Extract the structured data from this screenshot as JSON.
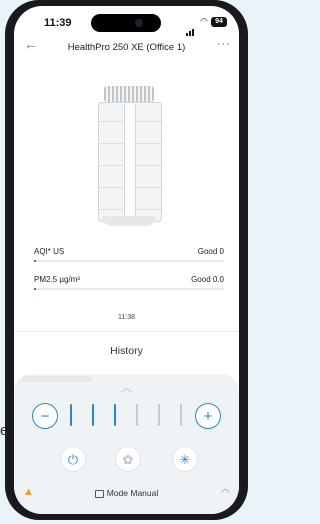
{
  "status_bar": {
    "time": "11:39",
    "battery": "94"
  },
  "nav": {
    "back_icon": "arrow-left-icon",
    "title": "HealthPro 250 XE (Office 1)",
    "more_icon": "more-dots-icon"
  },
  "metrics": [
    {
      "label": "AQI* US",
      "value": "Good 0",
      "level_fraction": 0.0
    },
    {
      "label": "PM2.5 µg/m³",
      "value": "Good 0.0",
      "level_fraction": 0.0
    }
  ],
  "updated_time": "11:38",
  "history_label": "History",
  "fan_control": {
    "minus_label": "−",
    "plus_label": "+",
    "speed_level": 3,
    "speed_max": 6,
    "active_color": "#2a86d6",
    "inactive_color": "#c3cbd3"
  },
  "controls": {
    "power_icon": "power-icon",
    "fan_icon": "fan-icon",
    "auto_icon": "sparkle-icon"
  },
  "bottom": {
    "warning_icon": "warning-icon",
    "mode_label": "Mode Manual",
    "wifi_icon": "wifi-icon"
  },
  "stray_text": "e",
  "colors": {
    "accent": "#2a86d6",
    "good": "#2a9a4a",
    "warning": "#f0a020"
  }
}
